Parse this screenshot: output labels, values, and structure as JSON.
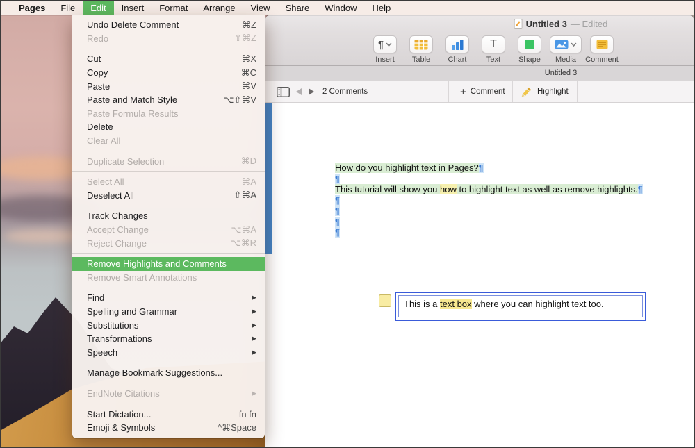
{
  "colors": {
    "accent": "#5cb95f",
    "highlight_green": "#d9edd3",
    "highlight_yellow": "#f6f0ae",
    "highlight_yellow_box": "#f8e890",
    "pilcrow_blue": "#3e7ed4",
    "pilcrow_bg": "#cfe4f7",
    "comment_pane_edge_blue": "#4384c8"
  },
  "menubar": {
    "items": [
      {
        "label": "Pages",
        "bold": true
      },
      {
        "label": "File"
      },
      {
        "label": "Edit",
        "active": true
      },
      {
        "label": "Insert"
      },
      {
        "label": "Format"
      },
      {
        "label": "Arrange"
      },
      {
        "label": "View"
      },
      {
        "label": "Share"
      },
      {
        "label": "Window"
      },
      {
        "label": "Help"
      }
    ]
  },
  "edit_menu": {
    "items": [
      {
        "label": "Undo Delete Comment",
        "shortcut": "⌘Z"
      },
      {
        "label": "Redo",
        "shortcut": "⇧⌘Z",
        "disabled": true
      },
      {
        "type": "separator"
      },
      {
        "label": "Cut",
        "shortcut": "⌘X"
      },
      {
        "label": "Copy",
        "shortcut": "⌘C"
      },
      {
        "label": "Paste",
        "shortcut": "⌘V"
      },
      {
        "label": "Paste and Match Style",
        "shortcut": "⌥⇧⌘V"
      },
      {
        "label": "Paste Formula Results",
        "disabled": true
      },
      {
        "label": "Delete"
      },
      {
        "label": "Clear All",
        "disabled": true
      },
      {
        "type": "separator"
      },
      {
        "label": "Duplicate Selection",
        "shortcut": "⌘D",
        "disabled": true
      },
      {
        "type": "separator"
      },
      {
        "label": "Select All",
        "shortcut": "⌘A",
        "disabled": true
      },
      {
        "label": "Deselect All",
        "shortcut": "⇧⌘A"
      },
      {
        "type": "separator"
      },
      {
        "label": "Track Changes"
      },
      {
        "label": "Accept Change",
        "shortcut": "⌥⌘A",
        "disabled": true
      },
      {
        "label": "Reject Change",
        "shortcut": "⌥⌘R",
        "disabled": true
      },
      {
        "type": "separator"
      },
      {
        "label": "Remove Highlights and Comments",
        "highlighted": true
      },
      {
        "label": "Remove Smart Annotations",
        "disabled": true
      },
      {
        "type": "separator"
      },
      {
        "label": "Find",
        "submenu": true
      },
      {
        "label": "Spelling and Grammar",
        "submenu": true
      },
      {
        "label": "Substitutions",
        "submenu": true
      },
      {
        "label": "Transformations",
        "submenu": true
      },
      {
        "label": "Speech",
        "submenu": true
      },
      {
        "type": "separator"
      },
      {
        "label": "Manage Bookmark Suggestions..."
      },
      {
        "type": "separator"
      },
      {
        "label": "EndNote Citations",
        "submenu": true,
        "disabled": true
      },
      {
        "type": "separator"
      },
      {
        "label": "Start Dictation...",
        "shortcut": "fn fn"
      },
      {
        "label": "Emoji & Symbols",
        "shortcut": "^⌘Space"
      }
    ]
  },
  "window": {
    "title": "Untitled 3",
    "edited_suffix": "— Edited",
    "tab_title": "Untitled 3",
    "toolbar_items": [
      {
        "label": "Insert",
        "icon": "pilcrow-icon",
        "dropdown": true
      },
      {
        "label": "Table",
        "icon": "table-icon"
      },
      {
        "label": "Chart",
        "icon": "chart-icon"
      },
      {
        "label": "Text",
        "icon": "text-icon"
      },
      {
        "label": "Shape",
        "icon": "shape-icon"
      },
      {
        "label": "Media",
        "icon": "media-icon",
        "dropdown": true
      },
      {
        "label": "Comment",
        "icon": "comment-icon"
      }
    ],
    "comments_bar": {
      "count_label": "2 Comments",
      "add_comment_label": "Comment",
      "highlight_label": "Highlight"
    }
  },
  "document": {
    "pilcrow_char": "¶",
    "p1": "How do you highlight text in Pages?",
    "p2_pre": "This tutorial will show you ",
    "p2_highlight": "how",
    "p2_post": " to highlight text as well as remove highlights.",
    "textbox": {
      "pre": "This is a ",
      "highlight": "text box",
      "post": " where you can highlight text too."
    }
  }
}
